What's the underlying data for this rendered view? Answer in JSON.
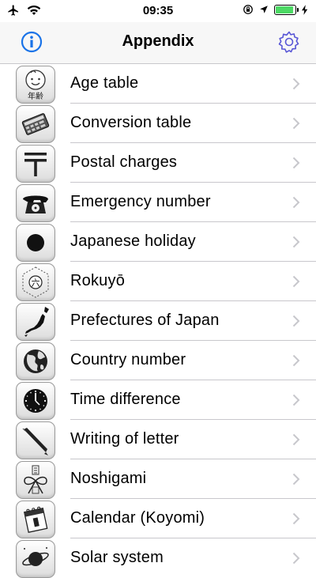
{
  "status_bar": {
    "time": "09:35",
    "icons": [
      "airplane-icon",
      "wifi-icon",
      "rotation-lock-icon",
      "location-icon",
      "battery-icon",
      "charging-icon"
    ],
    "battery_level": 0.85
  },
  "nav": {
    "title": "Appendix",
    "left_icon": "info-icon",
    "right_icon": "gear-icon",
    "tint_color": "#1a73e8",
    "settings_tint_color": "#5856d6"
  },
  "items": [
    {
      "label": "Age table",
      "icon": "baby-face-icon"
    },
    {
      "label": "Conversion table",
      "icon": "calculator-icon"
    },
    {
      "label": "Postal charges",
      "icon": "postal-mark-icon"
    },
    {
      "label": "Emergency number",
      "icon": "telephone-icon"
    },
    {
      "label": "Japanese holiday",
      "icon": "rising-sun-icon"
    },
    {
      "label": "Rokuyō",
      "icon": "rokuyo-chart-icon"
    },
    {
      "label": "Prefectures of Japan",
      "icon": "japan-map-icon"
    },
    {
      "label": "Country number",
      "icon": "globe-icon"
    },
    {
      "label": "Time difference",
      "icon": "clock-icon"
    },
    {
      "label": "Writing of letter",
      "icon": "pen-icon"
    },
    {
      "label": "Noshigami",
      "icon": "noshi-ribbon-icon"
    },
    {
      "label": "Calendar (Koyomi)",
      "icon": "calendar-icon"
    },
    {
      "label": "Solar system",
      "icon": "planet-icon"
    }
  ],
  "icon_glyphs": {
    "age_table": "年齢",
    "rokuyo": "六"
  }
}
